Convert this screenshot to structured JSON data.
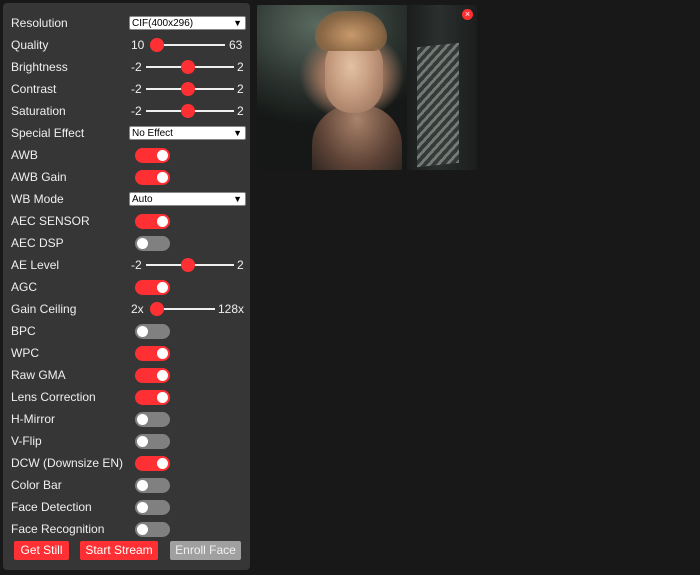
{
  "controls": {
    "resolution": {
      "label": "Resolution",
      "value": "CIF(400x296)"
    },
    "quality": {
      "label": "Quality",
      "min": "10",
      "max": "63",
      "value_fraction": 0.0
    },
    "brightness": {
      "label": "Brightness",
      "min": "-2",
      "max": "2",
      "value_fraction": 0.5
    },
    "contrast": {
      "label": "Contrast",
      "min": "-2",
      "max": "2",
      "value_fraction": 0.5
    },
    "saturation": {
      "label": "Saturation",
      "min": "-2",
      "max": "2",
      "value_fraction": 0.5
    },
    "special_effect": {
      "label": "Special Effect",
      "value": "No Effect"
    },
    "awb": {
      "label": "AWB",
      "on": true
    },
    "awb_gain": {
      "label": "AWB Gain",
      "on": true
    },
    "wb_mode": {
      "label": "WB Mode",
      "value": "Auto"
    },
    "aec_sensor": {
      "label": "AEC SENSOR",
      "on": true
    },
    "aec_dsp": {
      "label": "AEC DSP",
      "on": false
    },
    "ae_level": {
      "label": "AE Level",
      "min": "-2",
      "max": "2",
      "value_fraction": 0.5
    },
    "agc": {
      "label": "AGC",
      "on": true
    },
    "gain_ceiling": {
      "label": "Gain Ceiling",
      "min": "2x",
      "max": "128x",
      "value_fraction": 0.0
    },
    "bpc": {
      "label": "BPC",
      "on": false
    },
    "wpc": {
      "label": "WPC",
      "on": true
    },
    "raw_gma": {
      "label": "Raw GMA",
      "on": true
    },
    "lens_correction": {
      "label": "Lens Correction",
      "on": true
    },
    "h_mirror": {
      "label": "H-Mirror",
      "on": false
    },
    "v_flip": {
      "label": "V-Flip",
      "on": false
    },
    "dcw": {
      "label": "DCW (Downsize EN)",
      "on": true
    },
    "color_bar": {
      "label": "Color Bar",
      "on": false
    },
    "face_detection": {
      "label": "Face Detection",
      "on": false
    },
    "face_recognition": {
      "label": "Face Recognition",
      "on": false
    }
  },
  "buttons": {
    "get_still": "Get Still",
    "start_stream": "Start Stream",
    "enroll_face": "Enroll Face"
  },
  "icons": {
    "close": "close-icon",
    "chevron": "chevron-down-icon"
  },
  "colors": {
    "accent": "#ff3034",
    "panel": "#363636",
    "background": "#181818",
    "toggle_off": "#808080"
  }
}
